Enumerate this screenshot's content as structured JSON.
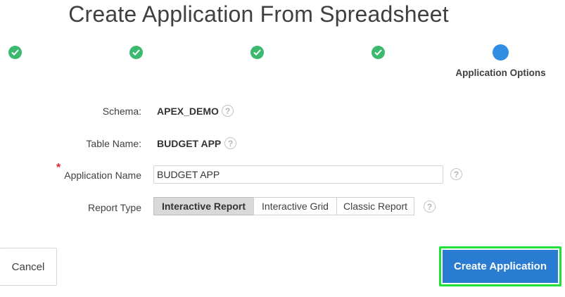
{
  "title": "Create Application From Spreadsheet",
  "wizard": {
    "current_step_label": "Application Options",
    "completed_steps": 4
  },
  "form": {
    "schema": {
      "label": "Schema:",
      "value": "APEX_DEMO"
    },
    "table_name": {
      "label": "Table Name:",
      "value": "BUDGET APP"
    },
    "application_name": {
      "label": "Application Name",
      "required_mark": "*",
      "value": "BUDGET APP"
    },
    "report_type": {
      "label": "Report Type",
      "options": [
        "Interactive Report",
        "Interactive Grid",
        "Classic Report"
      ],
      "selected": "Interactive Report"
    },
    "help_icon_text": "?"
  },
  "buttons": {
    "cancel": "Cancel",
    "create": "Create Application"
  },
  "colors": {
    "completed_step": "#3bba6f",
    "current_step": "#2f8ee3",
    "primary_button": "#2a7bd2",
    "highlight_border": "#22e03a"
  }
}
